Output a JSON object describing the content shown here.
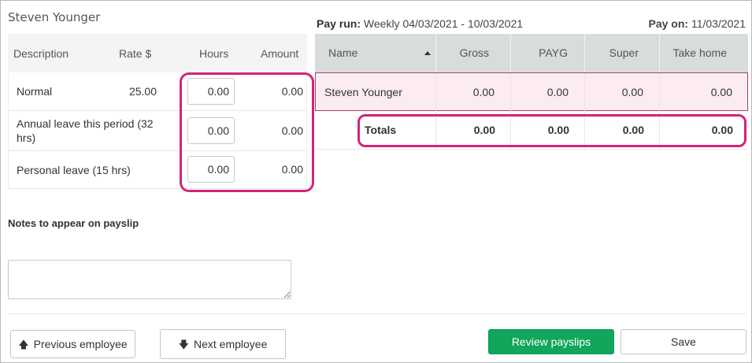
{
  "employee": {
    "name": "Steven Younger"
  },
  "pay_items": {
    "headers": {
      "description": "Description",
      "rate": "Rate $",
      "hours": "Hours",
      "amount": "Amount"
    },
    "rows": [
      {
        "description": "Normal",
        "rate": "25.00",
        "hours": "0.00",
        "amount": "0.00"
      },
      {
        "description": "Annual leave this period (32 hrs)",
        "rate": "",
        "hours": "0.00",
        "amount": "0.00"
      },
      {
        "description": "Personal leave (15 hrs)",
        "rate": "",
        "hours": "0.00",
        "amount": "0.00"
      }
    ]
  },
  "pay_run": {
    "label": "Pay run:",
    "value": "Weekly 04/03/2021 - 10/03/2021",
    "pay_on_label": "Pay on:",
    "pay_on_value": "11/03/2021"
  },
  "summary": {
    "headers": {
      "name": "Name",
      "gross": "Gross",
      "payg": "PAYG",
      "super": "Super",
      "take_home": "Take home"
    },
    "row": {
      "name": "Steven Younger",
      "gross": "0.00",
      "payg": "0.00",
      "super": "0.00",
      "take_home": "0.00"
    },
    "totals": {
      "label": "Totals",
      "gross": "0.00",
      "payg": "0.00",
      "super": "0.00",
      "take_home": "0.00"
    }
  },
  "notes": {
    "label": "Notes to appear on payslip",
    "value": ""
  },
  "buttons": {
    "previous": "Previous employee",
    "next": "Next employee",
    "review": "Review payslips",
    "save": "Save"
  },
  "colors": {
    "highlight": "#d4237a",
    "primary_button": "#11a65b",
    "header_bg": "#d8dcdd",
    "row_selected": "#fcecef"
  }
}
